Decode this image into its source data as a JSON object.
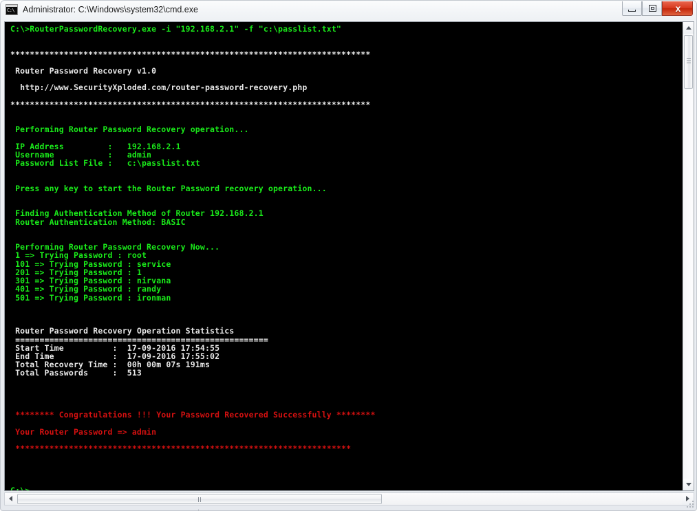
{
  "window": {
    "title": "Administrator: C:\\Windows\\system32\\cmd.exe",
    "icon_prompt": "C:\\",
    "controls": {
      "minimize_label": "–",
      "maximize_label": "□",
      "close_label": "x"
    }
  },
  "console": {
    "colors": {
      "background": "#000000",
      "green": "#1aeb1a",
      "white": "#e8e8e8",
      "red": "#d41010"
    },
    "lines": [
      {
        "color": "green",
        "text": "C:\\>RouterPasswordRecovery.exe -i \"192.168.2.1\" -f \"c:\\passlist.txt\""
      },
      {
        "color": "green",
        "text": ""
      },
      {
        "color": "green",
        "text": ""
      },
      {
        "color": "white",
        "text": "**************************************************************************"
      },
      {
        "color": "white",
        "text": ""
      },
      {
        "color": "white",
        "text": " Router Password Recovery v1.0"
      },
      {
        "color": "white",
        "text": ""
      },
      {
        "color": "white",
        "text": "  http://www.SecurityXploded.com/router-password-recovery.php"
      },
      {
        "color": "white",
        "text": ""
      },
      {
        "color": "white",
        "text": "**************************************************************************"
      },
      {
        "color": "green",
        "text": ""
      },
      {
        "color": "green",
        "text": ""
      },
      {
        "color": "green",
        "text": " Performing Router Password Recovery operation..."
      },
      {
        "color": "green",
        "text": ""
      },
      {
        "color": "green",
        "text": " IP Address         :   192.168.2.1"
      },
      {
        "color": "green",
        "text": " Username           :   admin"
      },
      {
        "color": "green",
        "text": " Password List File :   c:\\passlist.txt"
      },
      {
        "color": "green",
        "text": ""
      },
      {
        "color": "green",
        "text": ""
      },
      {
        "color": "green",
        "text": " Press any key to start the Router Password recovery operation..."
      },
      {
        "color": "green",
        "text": ""
      },
      {
        "color": "green",
        "text": ""
      },
      {
        "color": "green",
        "text": " Finding Authentication Method of Router 192.168.2.1"
      },
      {
        "color": "green",
        "text": " Router Authentication Method: BASIC"
      },
      {
        "color": "green",
        "text": ""
      },
      {
        "color": "green",
        "text": ""
      },
      {
        "color": "green",
        "text": " Performing Router Password Recovery Now..."
      },
      {
        "color": "green",
        "text": " 1 => Trying Password : root"
      },
      {
        "color": "green",
        "text": " 101 => Trying Password : service"
      },
      {
        "color": "green",
        "text": " 201 => Trying Password : 1"
      },
      {
        "color": "green",
        "text": " 301 => Trying Password : nirvana"
      },
      {
        "color": "green",
        "text": " 401 => Trying Password : randy"
      },
      {
        "color": "green",
        "text": " 501 => Trying Password : ironman"
      },
      {
        "color": "white",
        "text": ""
      },
      {
        "color": "white",
        "text": ""
      },
      {
        "color": "white",
        "text": ""
      },
      {
        "color": "white",
        "text": " Router Password Recovery Operation Statistics"
      },
      {
        "color": "white",
        "text": " ===================================================="
      },
      {
        "color": "white",
        "text": " Start Time          :  17-09-2016 17:54:55"
      },
      {
        "color": "white",
        "text": " End Time            :  17-09-2016 17:55:02"
      },
      {
        "color": "white",
        "text": " Total Recovery Time :  00h 00m 07s 191ms"
      },
      {
        "color": "white",
        "text": " Total Passwords     :  513"
      },
      {
        "color": "red",
        "text": ""
      },
      {
        "color": "red",
        "text": ""
      },
      {
        "color": "red",
        "text": ""
      },
      {
        "color": "red",
        "text": ""
      },
      {
        "color": "red",
        "text": " ******** Congratulations !!! Your Password Recovered Successfully ********"
      },
      {
        "color": "red",
        "text": ""
      },
      {
        "color": "red",
        "text": " Your Router Password => admin"
      },
      {
        "color": "red",
        "text": ""
      },
      {
        "color": "red",
        "text": " *********************************************************************"
      },
      {
        "color": "green",
        "text": ""
      },
      {
        "color": "green",
        "text": ""
      },
      {
        "color": "green",
        "text": ""
      },
      {
        "color": "green",
        "text": ""
      },
      {
        "color": "green",
        "text": "C:\\>"
      }
    ],
    "command": {
      "program": "RouterPasswordRecovery.exe",
      "flag_ip": "-i",
      "ip_value": "192.168.2.1",
      "flag_file": "-f",
      "file_value": "c:\\passlist.txt"
    },
    "banner": {
      "product": "Router Password Recovery v1.0",
      "url": "http://www.SecurityXploded.com/router-password-recovery.php"
    },
    "parameters": {
      "ip_address_label": "IP Address",
      "ip_address_value": "192.168.2.1",
      "username_label": "Username",
      "username_value": "admin",
      "password_list_label": "Password List File",
      "password_list_value": "c:\\passlist.txt"
    },
    "auth": {
      "finding": "Finding Authentication Method of Router 192.168.2.1",
      "method_label": "Router Authentication Method:",
      "method_value": "BASIC"
    },
    "attempts": [
      {
        "index": "1",
        "password": "root"
      },
      {
        "index": "101",
        "password": "service"
      },
      {
        "index": "201",
        "password": "1"
      },
      {
        "index": "301",
        "password": "nirvana"
      },
      {
        "index": "401",
        "password": "randy"
      },
      {
        "index": "501",
        "password": "ironman"
      }
    ],
    "statistics": {
      "heading": "Router Password Recovery Operation Statistics",
      "start_time_label": "Start Time",
      "start_time_value": "17-09-2016 17:54:55",
      "end_time_label": "End Time",
      "end_time_value": "17-09-2016 17:55:02",
      "total_time_label": "Total Recovery Time",
      "total_time_value": "00h 00m 07s 191ms",
      "total_passwords_label": "Total Passwords",
      "total_passwords_value": "513"
    },
    "result": {
      "congratulations": "******** Congratulations !!! Your Password Recovered Successfully ********",
      "recovered_label": "Your Router Password =>",
      "recovered_value": "admin"
    },
    "final_prompt": "C:\\>"
  }
}
